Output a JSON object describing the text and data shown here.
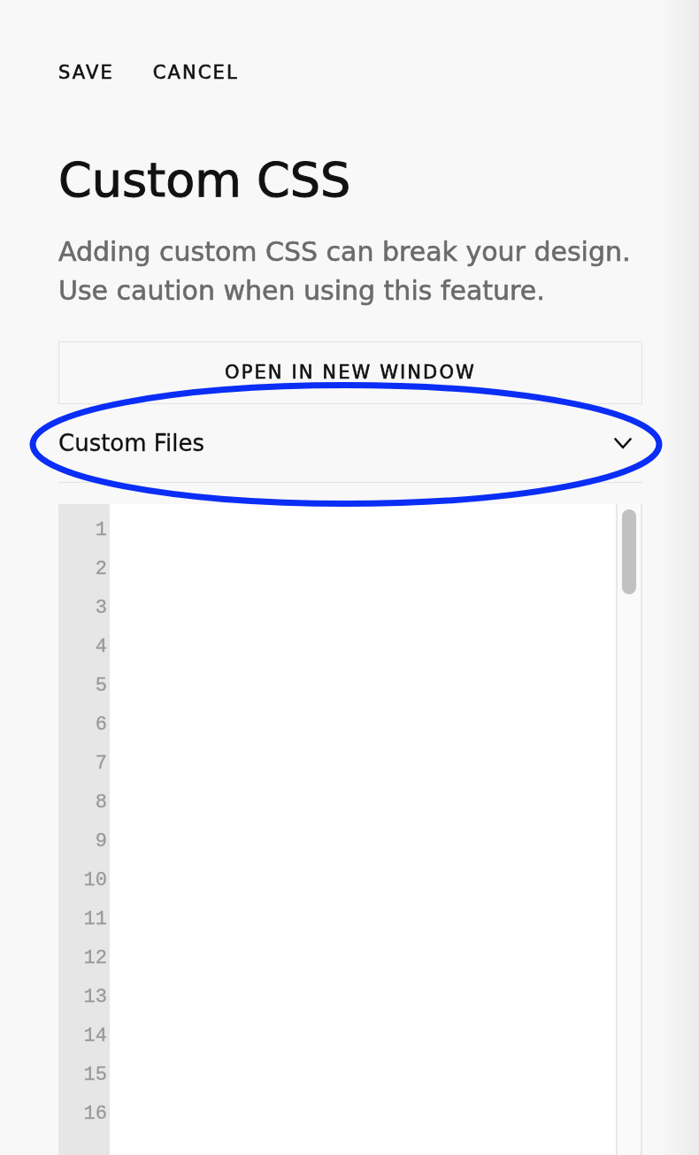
{
  "toolbar": {
    "buttons": [
      "SAVE",
      "CANCEL"
    ]
  },
  "title": "Custom CSS",
  "description": "Adding custom CSS can break your design. Use caution when using this feature.",
  "open_button": {
    "label": "OPEN IN NEW WINDOW"
  },
  "dropdown": {
    "label": "Custom Files",
    "expanded": false
  },
  "editor": {
    "line_numbers": [
      "1",
      "2",
      "3",
      "4",
      "5",
      "6",
      "7",
      "8",
      "9",
      "10",
      "11",
      "12",
      "13",
      "14",
      "15",
      "16"
    ]
  },
  "annotation": {
    "kind": "ellipse"
  }
}
